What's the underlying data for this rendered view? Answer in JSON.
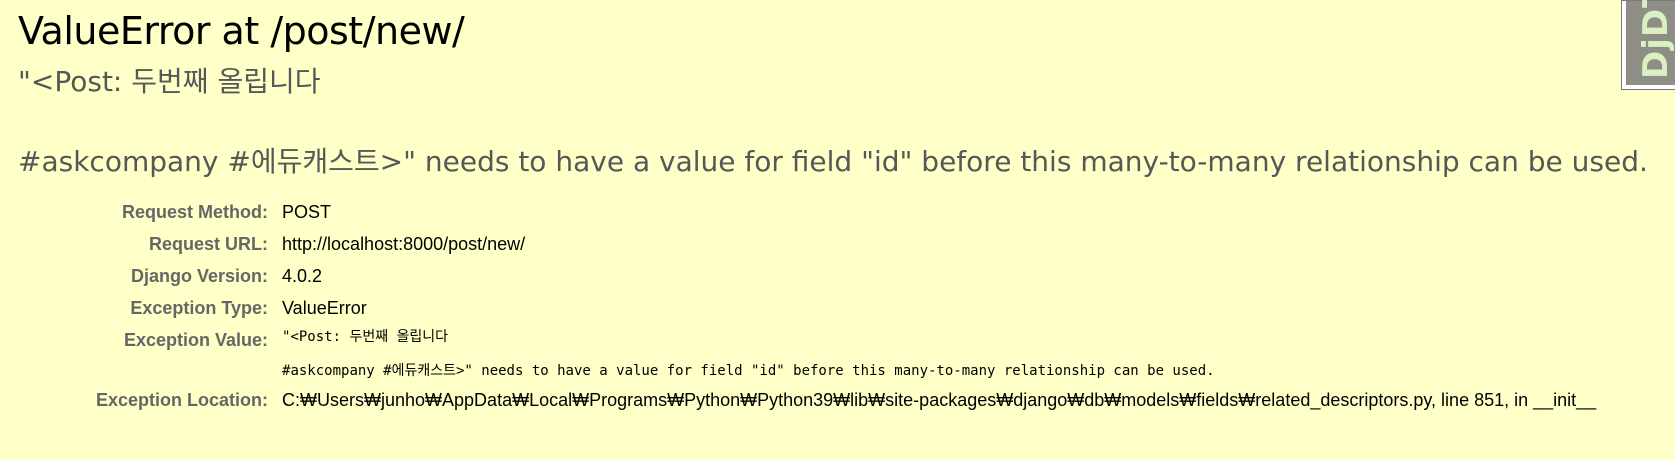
{
  "title": "ValueError at /post/new/",
  "exception_value": {
    "line1": "\"<Post: 두번째 올립니다",
    "line2": "#askcompany #에듀캐스트>\" needs to have a value for field \"id\" before this many-to-many relationship can be used."
  },
  "meta": [
    {
      "label": "Request Method:",
      "value": "POST"
    },
    {
      "label": "Request URL:",
      "value": "http://localhost:8000/post/new/"
    },
    {
      "label": "Django Version:",
      "value": "4.0.2"
    },
    {
      "label": "Exception Type:",
      "value": "ValueError"
    },
    {
      "label": "Exception Value:"
    },
    {
      "label": "Exception Location:",
      "value": "C:₩Users₩junho₩AppData₩Local₩Programs₩Python₩Python39₩lib₩site-packages₩django₩db₩models₩fields₩related_descriptors.py, line 851, in __init__"
    }
  ],
  "djdt": {
    "label": "DjDT"
  },
  "colors": {
    "background": "#ffffc8",
    "muted_text": "#575757",
    "label_text": "#666666"
  }
}
